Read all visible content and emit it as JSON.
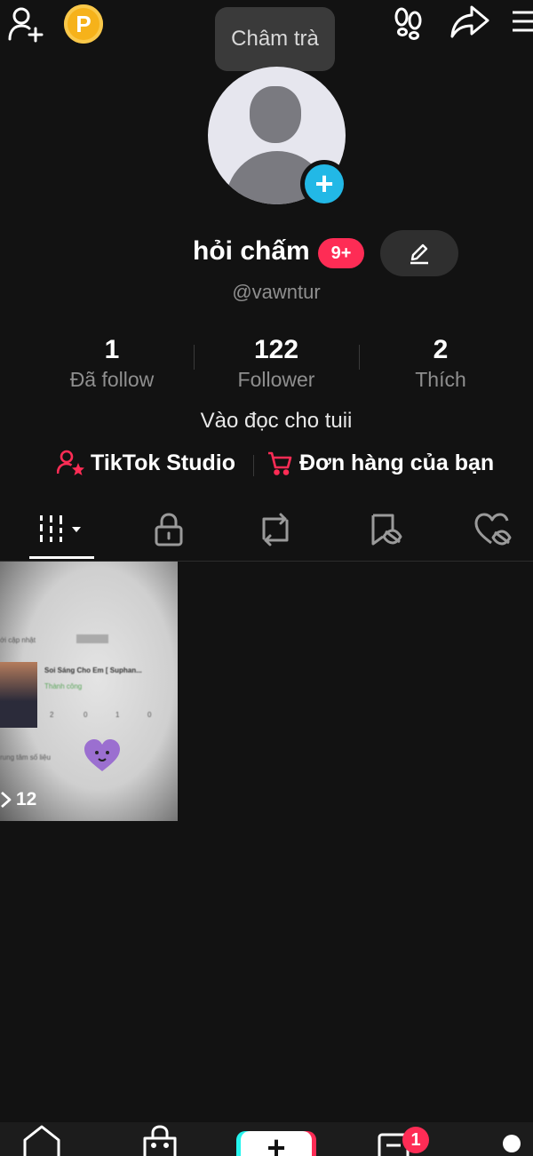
{
  "header": {
    "tooltip": "Châm trà",
    "coin_letter": "P"
  },
  "profile": {
    "display_name": "hỏi chấm",
    "notification_badge": "9+",
    "username": "@vawntur",
    "bio": "Vào đọc cho tuii"
  },
  "stats": [
    {
      "value": "1",
      "label": "Đã follow"
    },
    {
      "value": "122",
      "label": "Follower"
    },
    {
      "value": "2",
      "label": "Thích"
    }
  ],
  "links": {
    "studio": "TikTok Studio",
    "orders": "Đơn hàng của bạn"
  },
  "videos": [
    {
      "views": "12"
    }
  ],
  "bottom_nav": {
    "create_symbol": "+",
    "inbox_badge": "1"
  },
  "colors": {
    "background": "#121212",
    "accent_red": "#fe2c55",
    "accent_cyan": "#25f4ee",
    "plus_blue": "#22b8e6",
    "coin": "#f6b21a"
  }
}
